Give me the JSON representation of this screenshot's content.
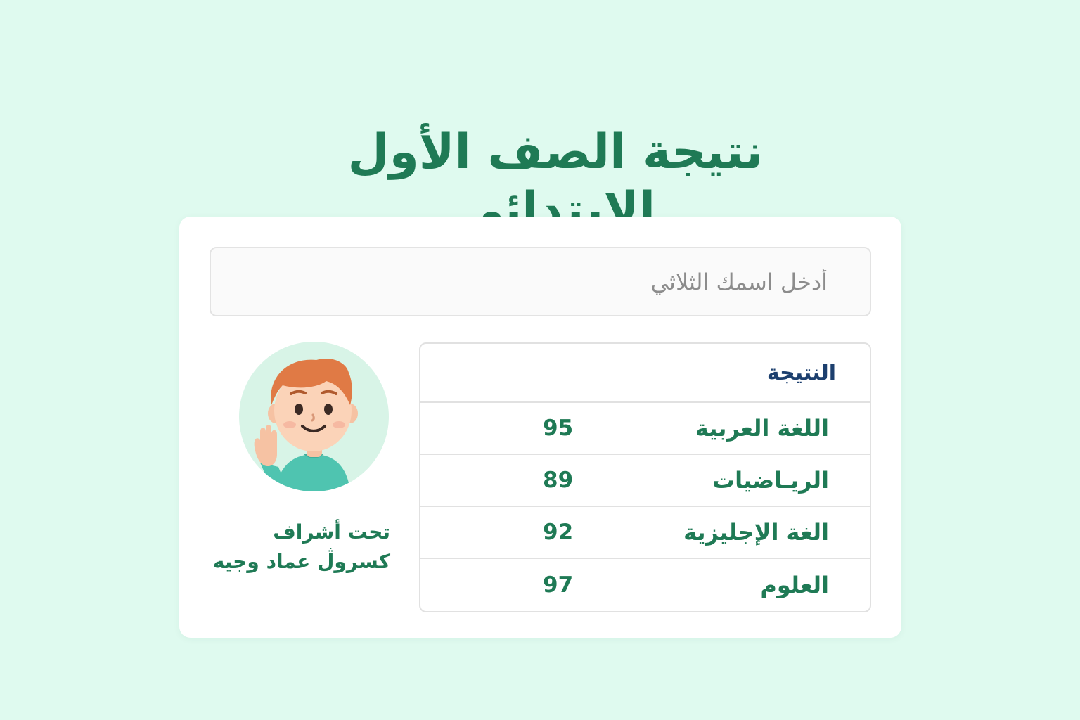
{
  "page": {
    "title": "نتيجة الصف الأول الإبتدائي"
  },
  "search": {
    "placeholder": "أدخل اسمك الثلاثي",
    "value": ""
  },
  "results": {
    "header": "النتيجة",
    "rows": [
      {
        "subject": "اللغة العربية",
        "score": "95"
      },
      {
        "subject": "الريـاضيات",
        "score": "89"
      },
      {
        "subject": "الغة الإجليزية",
        "score": "92"
      },
      {
        "subject": "العلوم",
        "score": "97"
      }
    ]
  },
  "supervisor": {
    "line1": "تحت أشراف",
    "line2": "كسروڷ عماد وجيه"
  },
  "avatar": {
    "icon": "boy-waving-avatar"
  },
  "colors": {
    "background": "#dffaef",
    "accent_green": "#1f7a55",
    "header_blue": "#1c3f6e"
  }
}
